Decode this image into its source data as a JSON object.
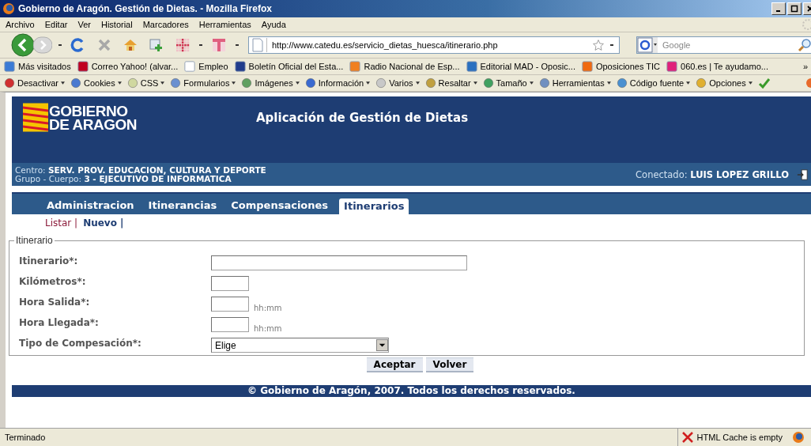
{
  "window": {
    "title": "Gobierno de Aragón. Gestión de Dietas. - Mozilla Firefox"
  },
  "menu": [
    "Archivo",
    "Editar",
    "Ver",
    "Historial",
    "Marcadores",
    "Herramientas",
    "Ayuda"
  ],
  "navigation": {
    "url": "http://www.catedu.es/servicio_dietas_huesca/itinerario.php",
    "search_placeholder": "Google"
  },
  "bookmarks": [
    {
      "label": "Más visitados"
    },
    {
      "label": "Correo Yahoo! (alvar..."
    },
    {
      "label": "Empleo"
    },
    {
      "label": "Boletín Oficial del Esta..."
    },
    {
      "label": "Radio Nacional de Esp..."
    },
    {
      "label": "Editorial MAD - Oposic..."
    },
    {
      "label": "Oposiciones TIC"
    },
    {
      "label": "060.es | Te ayudamo..."
    }
  ],
  "bookmarks_more": "»",
  "extension_toolbar": [
    {
      "label": "Desactivar"
    },
    {
      "label": "Cookies"
    },
    {
      "label": "CSS"
    },
    {
      "label": "Formularios"
    },
    {
      "label": "Imágenes"
    },
    {
      "label": "Información"
    },
    {
      "label": "Varios"
    },
    {
      "label": "Resaltar"
    },
    {
      "label": "Tamaño"
    },
    {
      "label": "Herramientas"
    },
    {
      "label": "Código fuente"
    },
    {
      "label": "Opciones"
    }
  ],
  "page": {
    "logo": [
      "GOBIERNO",
      "DE ARAGON"
    ],
    "app_title": "Aplicación de Gestión de Dietas",
    "centro": {
      "label": "Centro:",
      "value": "SERV. PROV. EDUCACION, CULTURA Y DEPORTE"
    },
    "grupo": {
      "label": "Grupo - Cuerpo:",
      "value": "3 - EJECUTIVO DE INFORMATICA"
    },
    "connected": {
      "label": "Conectado:",
      "value": "LUIS LOPEZ GRILLO"
    },
    "tabs": [
      {
        "label": "Administracion",
        "selected": false
      },
      {
        "label": "Itinerancias",
        "selected": false
      },
      {
        "label": "Compensaciones",
        "selected": false
      },
      {
        "label": "Itinerarios",
        "selected": true
      }
    ],
    "subnav": [
      {
        "label": "Listar |",
        "selected": false
      },
      {
        "label": "Nuevo |",
        "selected": true
      }
    ],
    "form": {
      "legend": "Itinerario",
      "fields": [
        {
          "label": "Itinerario*:",
          "kind": "wide"
        },
        {
          "label": "Kilómetros*:",
          "kind": "short"
        },
        {
          "label": "Hora Salida*:",
          "kind": "short",
          "hint": "hh:mm"
        },
        {
          "label": "Hora Llegada*:",
          "kind": "short",
          "hint": "hh:mm"
        },
        {
          "label": "Tipo de Compesación*:",
          "kind": "select",
          "value": "Elige"
        }
      ]
    },
    "buttons": [
      "Aceptar",
      "Volver"
    ],
    "footer": "© Gobierno de Aragón, 2007. Todos los derechos reservados."
  },
  "status_bar": {
    "text": "Terminado",
    "cache": "HTML Cache is empty"
  }
}
